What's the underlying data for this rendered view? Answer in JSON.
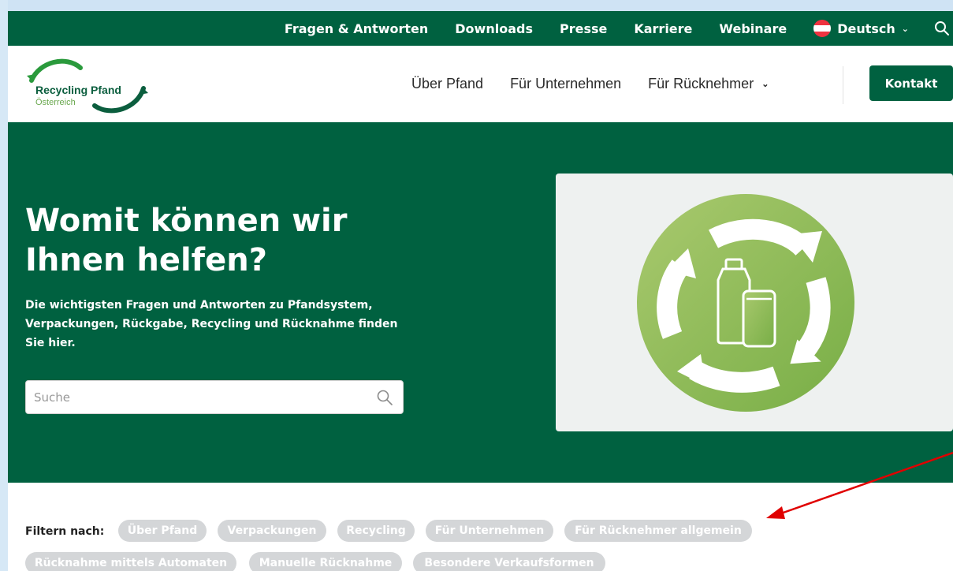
{
  "topbar": {
    "links": [
      "Fragen & Antworten",
      "Downloads",
      "Presse",
      "Karriere",
      "Webinare"
    ],
    "language": "Deutsch"
  },
  "header": {
    "logo_title": "Recycling Pfand",
    "logo_subtitle": "Österreich",
    "nav": [
      "Über Pfand",
      "Für Unternehmen",
      "Für Rücknehmer"
    ],
    "contact_label": "Kontakt"
  },
  "hero": {
    "title": "Womit können wir Ihnen helfen?",
    "lead": "Die wichtigsten Fragen und Antworten zu Pfandsystem, Verpackungen, Rückgabe, Recycling und Rücknahme finden Sie hier.",
    "search_placeholder": "Suche"
  },
  "filters": {
    "label": "Filtern nach:",
    "chips": [
      "Über Pfand",
      "Verpackungen",
      "Recycling",
      "Für Unternehmen",
      "Für Rücknehmer allgemein",
      "Rücknahme mittels Automaten",
      "Manuelle Rücknahme",
      "Besondere Verkaufsformen"
    ]
  },
  "colors": {
    "brand_green": "#006140",
    "chip_gray": "#d4d6d8",
    "annotation_arrow": "#e00000"
  }
}
